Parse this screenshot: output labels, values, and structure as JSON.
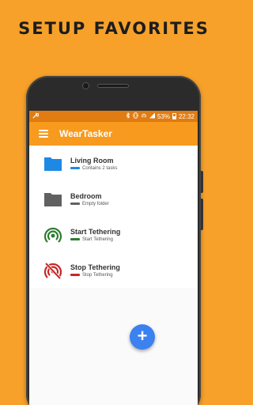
{
  "headline": "SETUP FAVORITES",
  "status_bar": {
    "battery": "53%",
    "time": "22:32",
    "icons": [
      "wrench-icon",
      "bluetooth-icon",
      "vibrate-icon",
      "hotspot-icon",
      "signal-icon",
      "battery-icon"
    ]
  },
  "app_bar": {
    "title": "WearTasker",
    "menu_icon": "hamburger-icon"
  },
  "items": [
    {
      "title": "Living Room",
      "subtitle": "Contains 2 tasks",
      "icon": "folder-icon",
      "color": "#1E88E5"
    },
    {
      "title": "Bedroom",
      "subtitle": "Empty folder",
      "icon": "folder-icon",
      "color": "#616161"
    },
    {
      "title": "Start Tethering",
      "subtitle": "Start Tethering",
      "icon": "hotspot-icon",
      "color": "#2E7D32"
    },
    {
      "title": "Stop Tethering",
      "subtitle": "Stop Tethering",
      "icon": "hotspot-off-icon",
      "color": "#C62828"
    }
  ],
  "fab": {
    "label": "+",
    "icon": "add-icon"
  },
  "colors": {
    "background": "#F7A12B",
    "status_bar": "#E07C12",
    "app_bar": "#F79A1D",
    "fab": "#3B82F0"
  }
}
